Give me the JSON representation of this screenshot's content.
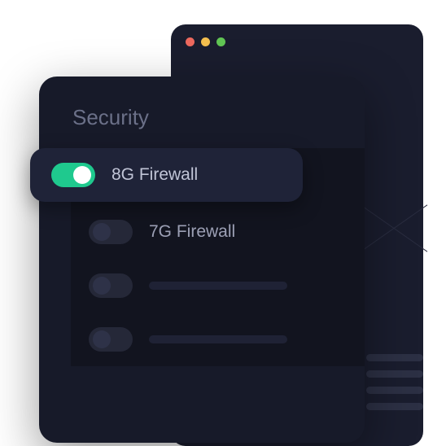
{
  "panel": {
    "title": "Security"
  },
  "settings": [
    {
      "label": "8G Firewall",
      "enabled": true
    },
    {
      "label": "7G Firewall",
      "enabled": false
    }
  ]
}
